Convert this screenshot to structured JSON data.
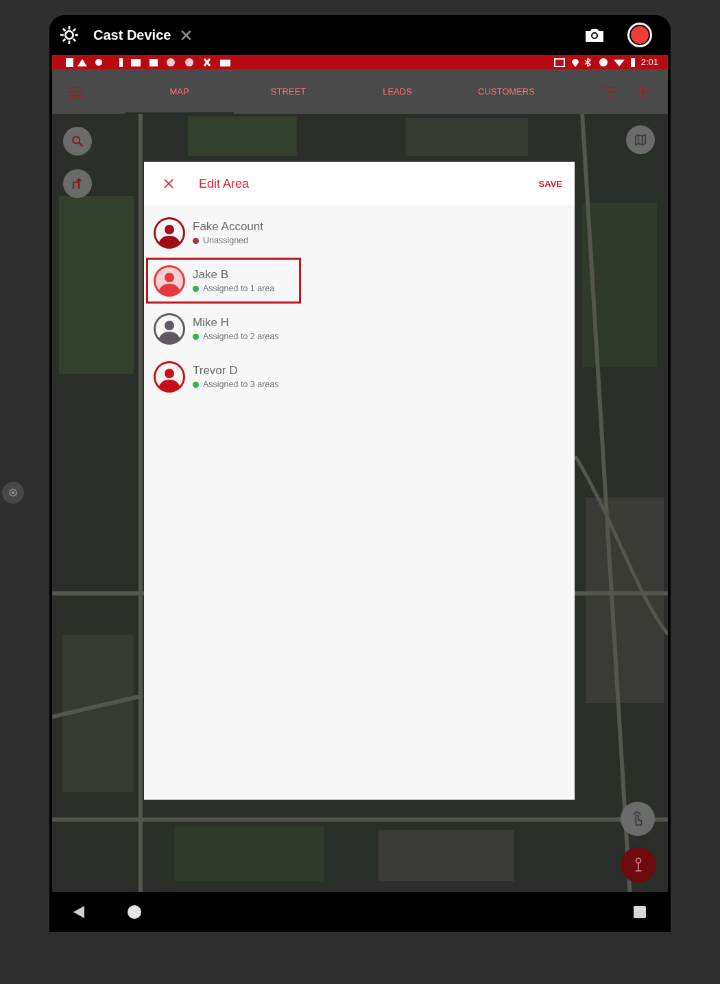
{
  "window": {
    "title": "Cast Device"
  },
  "status_bar": {
    "time": "2:01"
  },
  "app_bar": {
    "tabs": [
      {
        "label": "MAP",
        "selected": true
      },
      {
        "label": "STREET",
        "selected": false
      },
      {
        "label": "LEADS",
        "selected": false
      },
      {
        "label": "CUSTOMERS",
        "selected": false
      }
    ]
  },
  "dialog": {
    "title": "Edit Area",
    "action": "SAVE",
    "users": [
      {
        "name": "Fake Account",
        "status": "Unassigned",
        "color": "#a0353b",
        "avatar": {
          "color": "#a00d16"
        },
        "selected": false
      },
      {
        "name": "Jake B",
        "status": "Assigned to 1 area",
        "color": "#2db34a",
        "avatar": {
          "color": "#e5383f"
        },
        "selected": true
      },
      {
        "name": "Mike H",
        "status": "Assigned to 2 areas",
        "color": "#2db34a",
        "avatar": {
          "color": "#5f5a63"
        },
        "selected": false
      },
      {
        "name": "Trevor D",
        "status": "Assigned to 3 areas",
        "color": "#2db34a",
        "avatar": {
          "color": "#c8101a"
        },
        "selected": false
      }
    ]
  }
}
